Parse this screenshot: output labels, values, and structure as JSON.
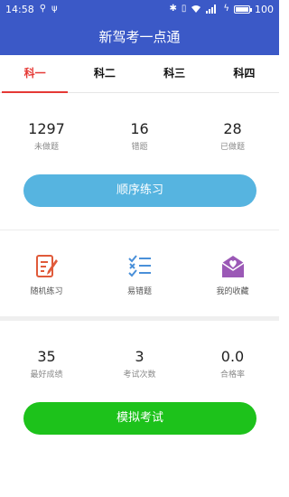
{
  "status_bar": {
    "time": "14:58",
    "battery": "100",
    "battery_level": 1.0,
    "left_icons": [
      "usb-icon",
      "usb-debug-icon"
    ],
    "right_icons": [
      "bluetooth-icon",
      "vibrate-icon",
      "wifi-icon",
      "signal-icon",
      "charging-icon",
      "battery-icon"
    ]
  },
  "header": {
    "title": "新驾考一点通"
  },
  "tabs": [
    {
      "label": "科一",
      "active": true
    },
    {
      "label": "科二",
      "active": false
    },
    {
      "label": "科三",
      "active": false
    },
    {
      "label": "科四",
      "active": false
    }
  ],
  "practice_stats": [
    {
      "value": "1297",
      "label": "未做题"
    },
    {
      "value": "16",
      "label": "错题"
    },
    {
      "value": "28",
      "label": "已做题"
    }
  ],
  "practice_button": {
    "label": "顺序练习"
  },
  "features": [
    {
      "label": "随机练习",
      "icon": "random-practice-icon"
    },
    {
      "label": "易错题",
      "icon": "error-prone-list-icon"
    },
    {
      "label": "我的收藏",
      "icon": "favorites-envelope-icon"
    }
  ],
  "exam_stats": [
    {
      "value": "35",
      "label": "最好成绩"
    },
    {
      "value": "3",
      "label": "考试次数"
    },
    {
      "value": "0.0",
      "label": "合格率"
    }
  ],
  "exam_button": {
    "label": "模拟考试"
  },
  "colors": {
    "header": "#3b59c7",
    "tab_active": "#e53935",
    "practice_button": "#56b4e0",
    "exam_button": "#1dc21b",
    "random_icon": "#e05a3a",
    "error_icon": "#4a90d9",
    "favorite_icon": "#9b59b6"
  }
}
